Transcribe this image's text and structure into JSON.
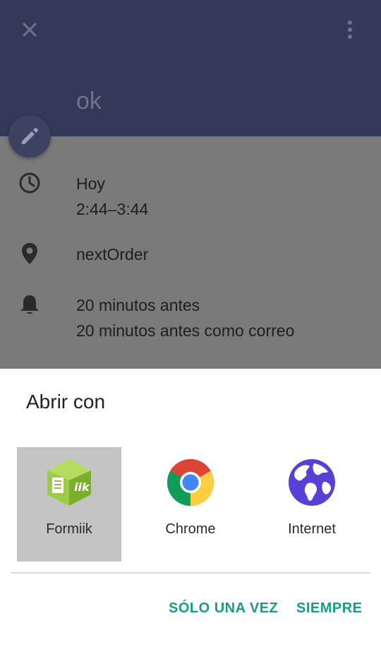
{
  "event": {
    "title": "ok",
    "date_label": "Hoy",
    "time_range": "2:44–3:44",
    "location": "nextOrder",
    "reminder_1": "20 minutos antes",
    "reminder_2": "20 minutos antes como correo"
  },
  "icons": {
    "close": "close-icon",
    "more": "more-vert-icon",
    "edit": "pencil-icon",
    "time": "clock-icon",
    "location": "location-pin-icon",
    "reminder": "bell-icon"
  },
  "chooser": {
    "title": "Abrir con",
    "apps": [
      {
        "label": "Formiik",
        "icon": "formiik-icon",
        "selected": true
      },
      {
        "label": "Chrome",
        "icon": "chrome-icon",
        "selected": false
      },
      {
        "label": "Internet",
        "icon": "globe-icon",
        "selected": false
      }
    ],
    "once_label": "SÓLO UNA VEZ",
    "always_label": "SIEMPRE"
  },
  "colors": {
    "header": "#333a58",
    "accent": "#1a9a8c",
    "selected_tile": "#c4c4c4"
  }
}
